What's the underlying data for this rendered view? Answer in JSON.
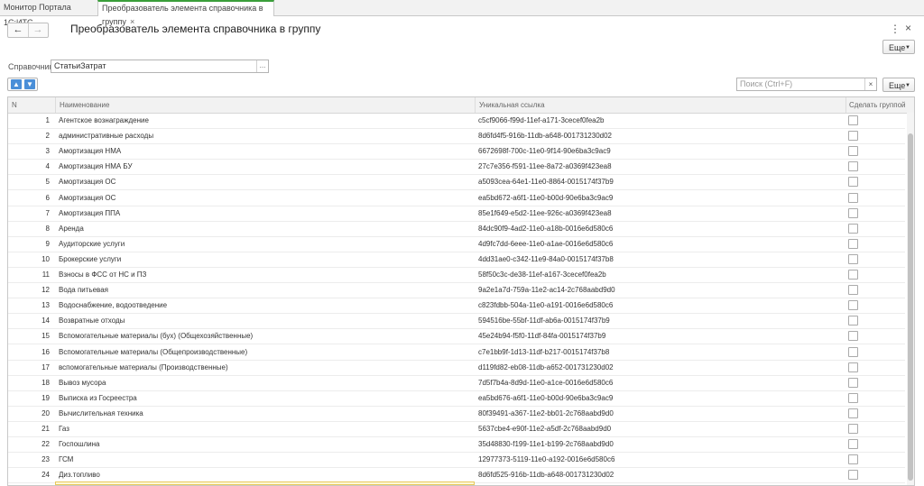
{
  "tabs": [
    {
      "label": "Монитор Портала 1С:ИТС"
    },
    {
      "label": "Преобразователь элемента справочника в группу",
      "close": "×"
    }
  ],
  "nav": {
    "back": "←",
    "forward": "→"
  },
  "title": "Преобразователь элемента справочника в группу",
  "window_controls": {
    "menu": "⋮",
    "close": "×"
  },
  "more_label": "Еще",
  "catalog": {
    "label": "Справочник:",
    "value": "СтатьиЗатрат",
    "choose": "..."
  },
  "search": {
    "placeholder": "Поиск (Ctrl+F)",
    "clear": "×"
  },
  "table": {
    "columns": [
      "N",
      "Наименование",
      "Уникальная ссылка",
      "Сделать группой"
    ],
    "rows": [
      {
        "n": "1",
        "name": "Агентское вознаграждение",
        "ref": "c5cf9066-f99d-11ef-a171-3cecef0fea2b"
      },
      {
        "n": "2",
        "name": "административные расходы",
        "ref": "8d6fd4f5-916b-11db-a648-001731230d02"
      },
      {
        "n": "3",
        "name": "Амортизация НМА",
        "ref": "6672698f-700c-11e0-9f14-90e6ba3c9ac9"
      },
      {
        "n": "4",
        "name": "Амортизация НМА БУ",
        "ref": "27c7e356-f591-11ee-8a72-a0369f423ea8"
      },
      {
        "n": "5",
        "name": "Амортизация ОС",
        "ref": "a5093cea-64e1-11e0-8864-0015174f37b9"
      },
      {
        "n": "6",
        "name": "Амортизация ОС",
        "ref": "ea5bd672-a6f1-11e0-b00d-90e6ba3c9ac9"
      },
      {
        "n": "7",
        "name": "Амортизация ППА",
        "ref": "85e1f649-e5d2-11ee-926c-a0369f423ea8"
      },
      {
        "n": "8",
        "name": "Аренда",
        "ref": "84dc90f9-4ad2-11e0-a18b-0016e6d580c6"
      },
      {
        "n": "9",
        "name": "Аудиторские услуги",
        "ref": "4d9fc7dd-6eee-11e0-a1ae-0016e6d580c6"
      },
      {
        "n": "10",
        "name": "Брокерские услуги",
        "ref": "4dd31ae0-c342-11e9-84a0-0015174f37b8"
      },
      {
        "n": "11",
        "name": "Взносы в ФСС от НС и ПЗ",
        "ref": "58f50c3c-de38-11ef-a167-3cecef0fea2b"
      },
      {
        "n": "12",
        "name": "Вода питьевая",
        "ref": "9a2e1a7d-759a-11e2-ac14-2c768aabd9d0"
      },
      {
        "n": "13",
        "name": "Водоснабжение, водоотведение",
        "ref": "c823fdbb-504a-11e0-a191-0016e6d580c6"
      },
      {
        "n": "14",
        "name": "Возвратные отходы",
        "ref": "594516be-55bf-11df-ab6a-0015174f37b9"
      },
      {
        "n": "15",
        "name": "Вспомогательные материалы (бух) (Общехозяйственные)",
        "ref": "45e24b94-f5f0-11df-84fa-0015174f37b9"
      },
      {
        "n": "16",
        "name": "Вспомогательные материалы (Общепроизводственные)",
        "ref": "c7e1bb9f-1d13-11df-b217-0015174f37b8"
      },
      {
        "n": "17",
        "name": "вспомогательные материалы (Производственные)",
        "ref": "d119fd82-eb08-11db-a652-001731230d02"
      },
      {
        "n": "18",
        "name": "Вывоз мусора",
        "ref": "7d5f7b4a-8d9d-11e0-a1ce-0016e6d580c6"
      },
      {
        "n": "19",
        "name": "Выписка из Госреестра",
        "ref": "ea5bd676-a6f1-11e0-b00d-90e6ba3c9ac9"
      },
      {
        "n": "20",
        "name": "Вычислительная техника",
        "ref": "80f39491-a367-11e2-bb01-2c768aabd9d0"
      },
      {
        "n": "21",
        "name": "Газ",
        "ref": "5637cbe4-e90f-11e2-a5df-2c768aabd9d0"
      },
      {
        "n": "22",
        "name": "Госпошлина",
        "ref": "35d48830-f199-11e1-b199-2c768aabd9d0"
      },
      {
        "n": "23",
        "name": "ГСМ",
        "ref": "12977373-5119-11e0-a192-0016e6d580c6"
      },
      {
        "n": "24",
        "name": "Диз.топливо",
        "ref": "8d6fd525-916b-11db-a648-001731230d02"
      }
    ]
  }
}
